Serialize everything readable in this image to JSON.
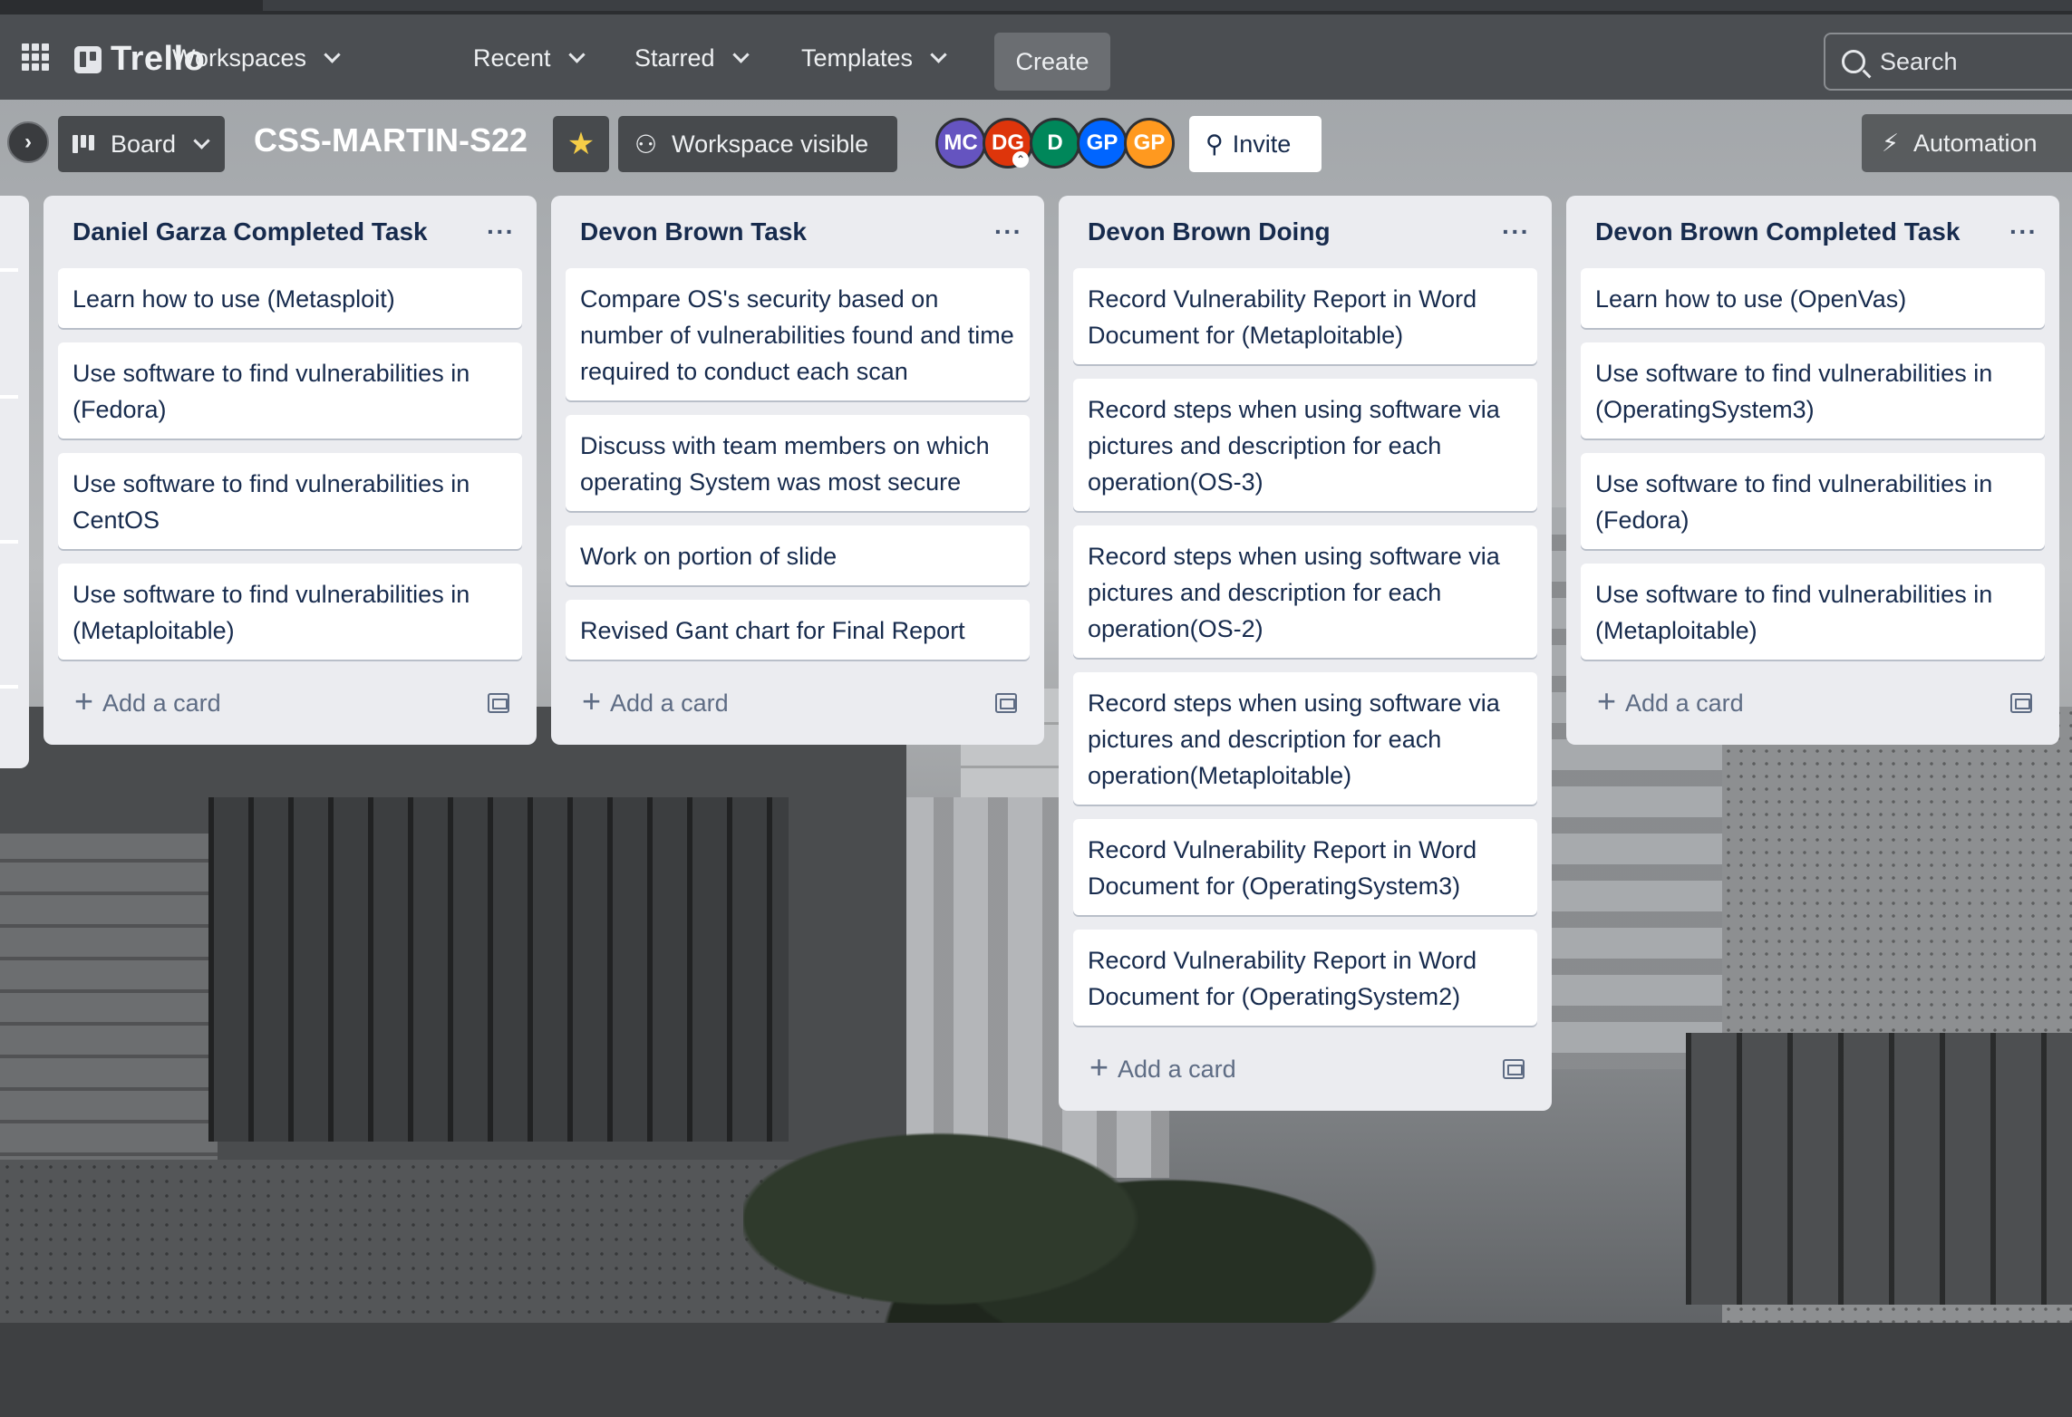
{
  "app": {
    "name": "Trello"
  },
  "nav": {
    "menus": [
      {
        "label": "Workspaces"
      },
      {
        "label": "Recent"
      },
      {
        "label": "Starred"
      },
      {
        "label": "Templates"
      }
    ],
    "create_label": "Create",
    "search_placeholder": "Search"
  },
  "board": {
    "view_label": "Board",
    "title": "CSS-MARTIN-S22",
    "visibility_label": "Workspace visible",
    "invite_label": "Invite",
    "automation_label": "Automation",
    "members": [
      {
        "initials": "MC",
        "color": "#6554c0"
      },
      {
        "initials": "DG",
        "color": "#de350b"
      },
      {
        "initials": "D",
        "color": "#00875a"
      },
      {
        "initials": "GP",
        "color": "#0065ff"
      },
      {
        "initials": "GP",
        "color": "#ff991f"
      }
    ]
  },
  "colors": {
    "star": "#f5cd47",
    "list_bg": "#ebecf0",
    "nav_bg": "#4b4e52"
  },
  "lists": [
    {
      "title": "Daniel Garza Completed Task",
      "menu": "···",
      "cards": [
        "Learn how to use (Metasploit)",
        "Use software to find vulnerabilities in (Fedora)",
        "Use software to find vulnerabilities in CentOS",
        "Use software to find vulnerabilities in (Metaploitable)"
      ],
      "add_label": "Add a card"
    },
    {
      "title": "Devon Brown Task",
      "menu": "···",
      "cards": [
        "Compare OS's security based on number of vulnerabilities found and time required to conduct each scan",
        "Discuss with team members on which operating System was most secure",
        "Work on portion of slide",
        "Revised Gant chart for Final Report"
      ],
      "add_label": "Add a card"
    },
    {
      "title": "Devon Brown Doing",
      "menu": "···",
      "cards": [
        "Record Vulnerability Report in Word Document for (Metaploitable)",
        "Record steps when using software via pictures and description for each operation(OS-3)",
        "Record steps when using software via pictures and description for each operation(OS-2)",
        "Record steps when using software via pictures and description for each operation(Metaploitable)",
        "Record Vulnerability Report in Word Document for (OperatingSystem3)",
        "Record Vulnerability Report in Word Document for (OperatingSystem2)"
      ],
      "add_label": "Add a card"
    },
    {
      "title": "Devon Brown Completed Task",
      "menu": "···",
      "cards": [
        "Learn how to use (OpenVas)",
        "Use software to find vulnerabilities in (OperatingSystem3)",
        "Use software to find vulnerabilities in (Fedora)",
        "Use software to find vulnerabilities in (Metaploitable)"
      ],
      "add_label": "Add a card"
    }
  ]
}
